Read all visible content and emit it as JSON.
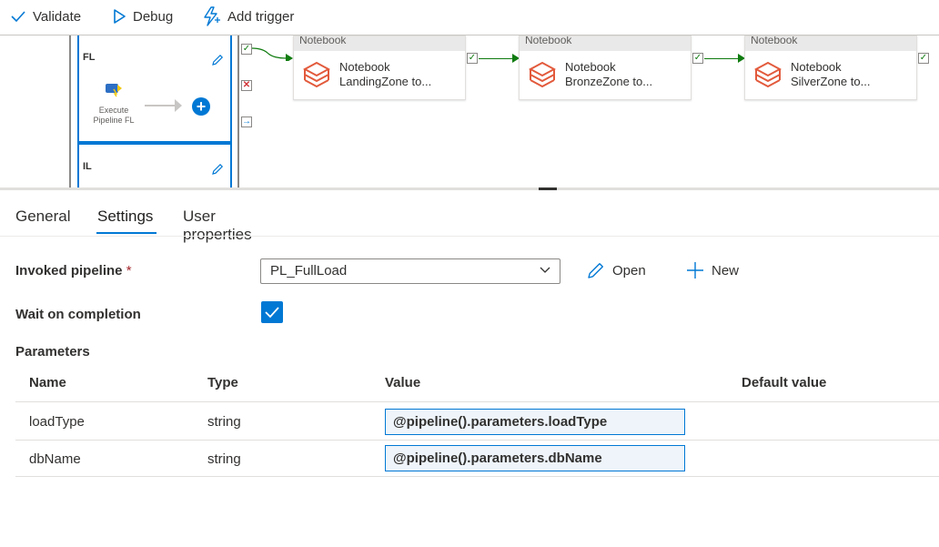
{
  "toolbar": {
    "validate_label": "Validate",
    "debug_label": "Debug",
    "add_trigger_label": "Add trigger"
  },
  "canvas": {
    "cases": [
      {
        "label": "FL",
        "activity_line1": "Execute",
        "activity_line2": "Pipeline FL"
      },
      {
        "label": "IL"
      }
    ],
    "notebooks": [
      {
        "header": "Notebook",
        "line1": "Notebook",
        "line2": "LandingZone to..."
      },
      {
        "header": "Notebook",
        "line1": "Notebook",
        "line2": "BronzeZone to..."
      },
      {
        "header": "Notebook",
        "line1": "Notebook",
        "line2": "SilverZone to..."
      }
    ]
  },
  "tabs": [
    {
      "label": "General"
    },
    {
      "label": "Settings",
      "active": true
    },
    {
      "label": "User properties"
    }
  ],
  "form": {
    "invoked_pipeline_label": "Invoked pipeline",
    "required_mark": "*",
    "invoked_pipeline_value": "PL_FullLoad",
    "open_label": "Open",
    "new_label": "New",
    "wait_label": "Wait on completion",
    "wait_checked": true,
    "parameters_label": "Parameters"
  },
  "parameters": {
    "headers": {
      "name": "Name",
      "type": "Type",
      "value": "Value",
      "default": "Default value"
    },
    "rows": [
      {
        "name": "loadType",
        "type": "string",
        "value": "@pipeline().parameters.loadType"
      },
      {
        "name": "dbName",
        "type": "string",
        "value": "@pipeline().parameters.dbName"
      }
    ]
  },
  "colors": {
    "accent": "#0078d4",
    "success": "#107c10",
    "failure": "#d13438",
    "notebook_icon": "#e25a3c"
  }
}
